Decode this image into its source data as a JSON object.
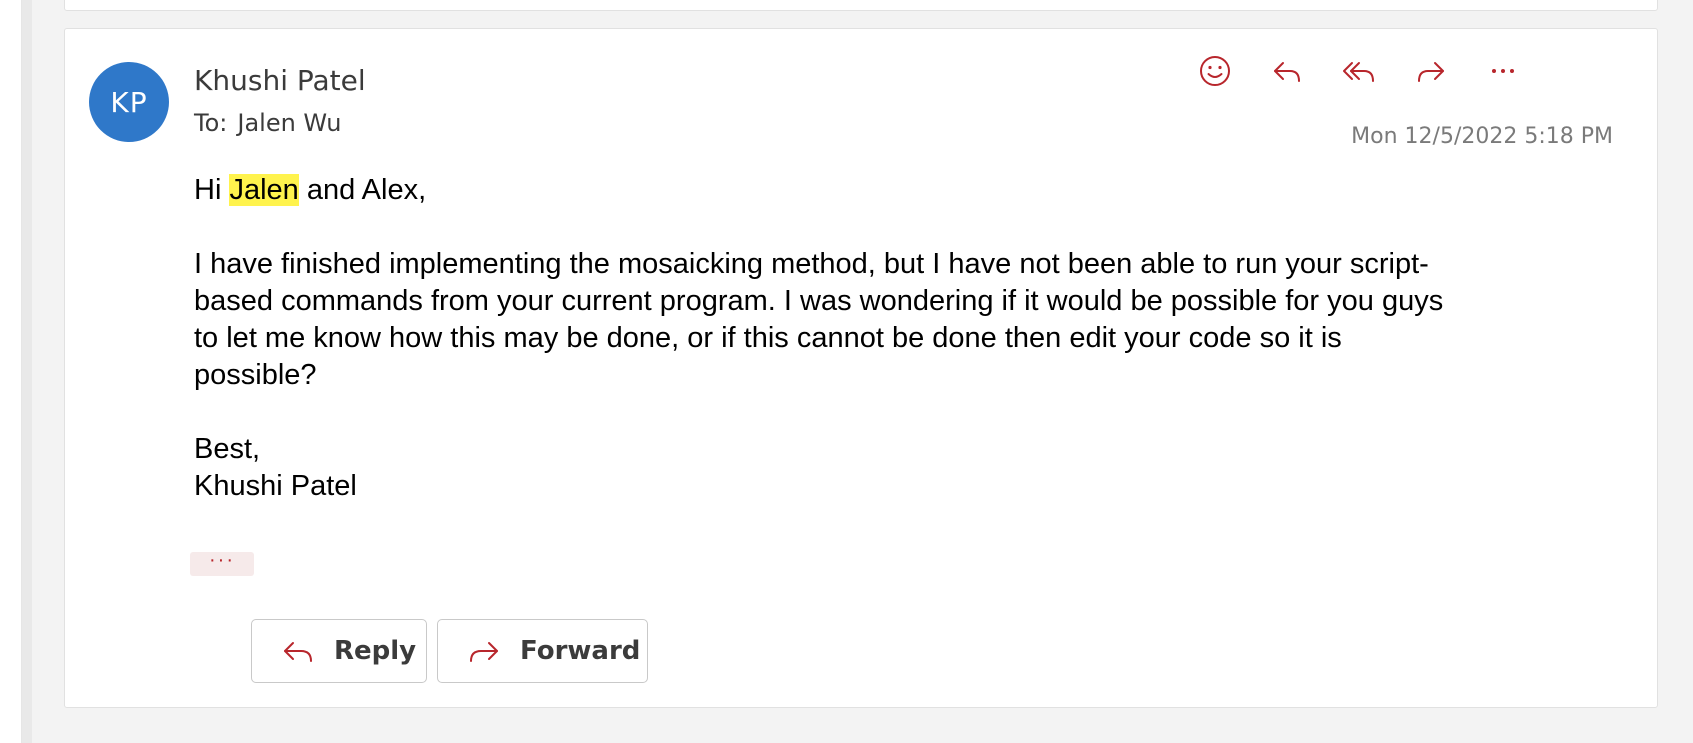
{
  "colors": {
    "accent": "#b8262c",
    "avatar_bg": "#2f78c9",
    "highlight": "#fff34d"
  },
  "message": {
    "avatar_initials": "KP",
    "sender_name": "Khushi Patel",
    "to_label": "To:",
    "to_name": "Jalen Wu",
    "timestamp": "Mon 12/5/2022 5:18 PM",
    "actions": [
      "smile-icon",
      "reply-icon",
      "reply-all-icon",
      "forward-icon",
      "more-icon"
    ],
    "body": {
      "greeting_prefix": "Hi ",
      "greeting_highlight": "Jalen",
      "greeting_suffix": " and Alex,",
      "paragraph_line_1": "I have finished implementing the mosaicking method, but I have not been able to run your script-",
      "paragraph_line_2": "based commands from your current program. I was wondering if it would be possible for you guys",
      "paragraph_line_3": "to let me know how this may be done, or if this cannot be done then edit your code so it is",
      "paragraph_line_4": "possible?",
      "signoff": "Best,",
      "signature": "Khushi Patel"
    },
    "expand_label": "···"
  },
  "footer": {
    "reply_label": "Reply",
    "forward_label": "Forward"
  }
}
